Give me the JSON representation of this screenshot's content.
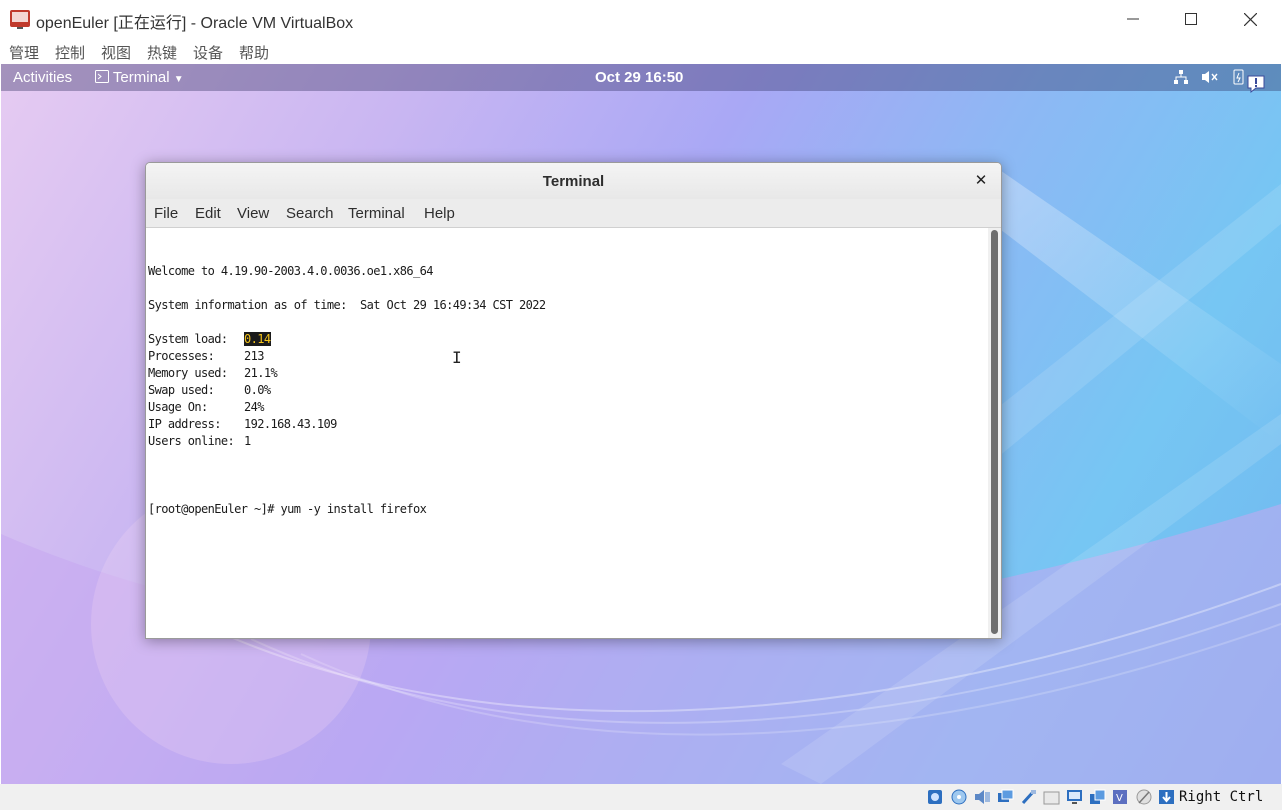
{
  "vbox": {
    "title": "openEuler [正在运行] - Oracle VM VirtualBox",
    "menu": [
      "管理",
      "控制",
      "视图",
      "热键",
      "设备",
      "帮助"
    ],
    "host_key": "Right Ctrl"
  },
  "gnome": {
    "activities": "Activities",
    "app_menu": "Terminal",
    "clock": "Oct 29  16:50"
  },
  "terminal": {
    "title": "Terminal",
    "menu": [
      "File",
      "Edit",
      "View",
      "Search",
      "Terminal",
      "Help"
    ],
    "welcome": "Welcome to 4.19.90-2003.4.0.0036.oe1.x86_64",
    "sysinfo": "System information as of time:  Sat Oct 29 16:49:34 CST 2022",
    "stats": [
      {
        "label": "System load:",
        "value": "0.14"
      },
      {
        "label": "Processes:",
        "value": "213"
      },
      {
        "label": "Memory used:",
        "value": "21.1%"
      },
      {
        "label": "Swap used:",
        "value": "0.0%"
      },
      {
        "label": "Usage On:",
        "value": "24%"
      },
      {
        "label": "IP address:",
        "value": "192.168.43.109"
      },
      {
        "label": "Users online:",
        "value": "1"
      }
    ],
    "prompt": "[root@openEuler ~]# yum -y install firefox"
  },
  "icons": {
    "status_bar": [
      "hard-disk-icon",
      "optical-drive-icon",
      "audio-icon",
      "network-icon",
      "usb-icon",
      "shared-folder-icon",
      "display-icon",
      "recording-icon",
      "cpu-virtualization-icon",
      "mouse-integration-icon",
      "keyboard-capture-icon"
    ]
  },
  "colors": {
    "highlight_bg": "#1a1a1a",
    "highlight_fg": "#f2c21b",
    "gnome_bar": "#3d3d6e"
  }
}
